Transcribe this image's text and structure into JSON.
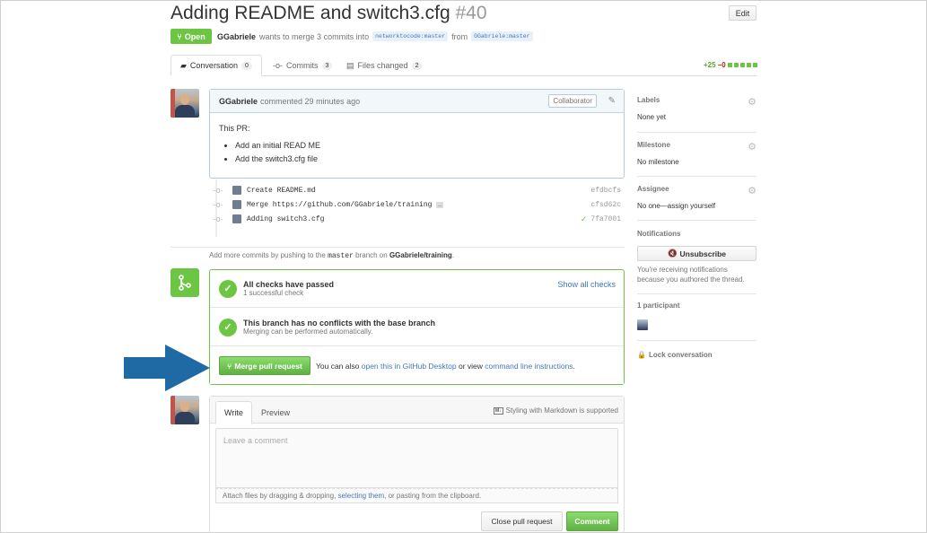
{
  "header": {
    "title": "Adding README and switch3.cfg",
    "number": "#40",
    "edit_label": "Edit",
    "state": "Open",
    "author": "GGabriele",
    "meta_mid": "wants to merge 3 commits into",
    "base_branch": "networktocode:master",
    "from_word": "from",
    "head_branch": "GGabriele:master"
  },
  "tabs": [
    {
      "label": "Conversation",
      "count": "0",
      "icon": "conversation-icon"
    },
    {
      "label": "Commits",
      "count": "3",
      "icon": "commit-icon"
    },
    {
      "label": "Files changed",
      "count": "2",
      "icon": "file-diff-icon"
    }
  ],
  "diffstat": {
    "additions": "+25",
    "deletions": "−0"
  },
  "comment": {
    "author": "GGabriele",
    "time": "commented 29 minutes ago",
    "badge": "Collaborator",
    "intro": "This PR:",
    "items": [
      "Add an initial READ ME",
      "Add the switch3.cfg file"
    ]
  },
  "commits": [
    {
      "message": "Create README.md",
      "sha": "efdbcfs",
      "ellipsis": "",
      "check": ""
    },
    {
      "message": "Merge https://github.com/GGabriele/training",
      "sha": "cfsd62c",
      "ellipsis": "…",
      "check": ""
    },
    {
      "message": "Adding switch3.cfg",
      "sha": "7fa7001",
      "ellipsis": "",
      "check": "✓"
    }
  ],
  "add_more": {
    "prefix": "Add more commits by pushing to the",
    "branch": "master",
    "mid": "branch on",
    "repo": "GGabriele/training",
    "suffix": "."
  },
  "merge": {
    "checks_title": "All checks have passed",
    "checks_sub": "1 successful check",
    "show_all": "Show all checks",
    "conflict_title": "This branch has no conflicts with the base branch",
    "conflict_sub": "Merging can be performed automatically.",
    "button": "Merge pull request",
    "also_prefix": "You can also",
    "desktop_link": "open this in GitHub Desktop",
    "or_view": "or view",
    "cli_link": "command line instructions",
    "also_suffix": "."
  },
  "new_comment": {
    "write_tab": "Write",
    "preview_tab": "Preview",
    "md_hint": "Styling with Markdown is supported",
    "placeholder": "Leave a comment",
    "attach_prefix": "Attach files by dragging & dropping,",
    "attach_link": "selecting them",
    "attach_suffix": ", or pasting from the clipboard.",
    "close_label": "Close pull request",
    "comment_label": "Comment"
  },
  "sidebar": {
    "labels_h": "Labels",
    "labels_v": "None yet",
    "milestone_h": "Milestone",
    "milestone_v": "No milestone",
    "assignee_h": "Assignee",
    "assignee_v": "No one—assign yourself",
    "notif_h": "Notifications",
    "unsub": "Unsubscribe",
    "notif_text": "You're receiving notifications because you authored the thread.",
    "participants_h": "1 participant",
    "lock": "Lock conversation"
  },
  "colors": {
    "accent_green": "#6cc644",
    "link_blue": "#4078c0",
    "arrow_blue": "#1f6aa5"
  }
}
